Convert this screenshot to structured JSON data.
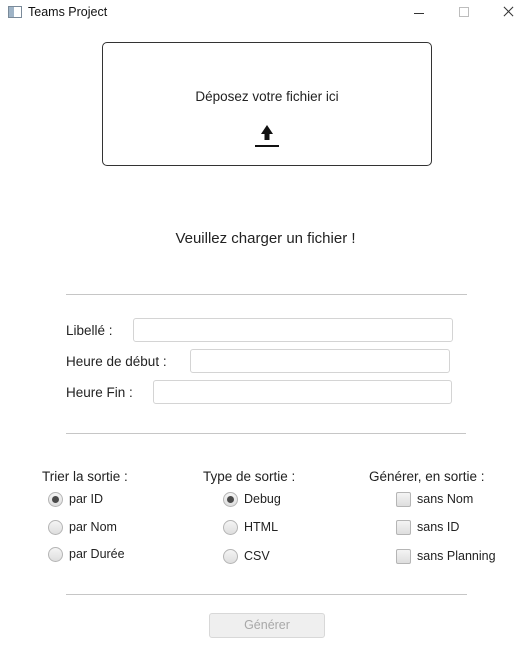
{
  "window": {
    "title": "Teams Project"
  },
  "dropzone": {
    "text": "Déposez votre fichier ici",
    "icon": "upload-icon"
  },
  "status": {
    "message": "Veuillez charger un fichier !"
  },
  "form": {
    "libelle_label": "Libellé :",
    "libelle_value": "",
    "heure_debut_label": "Heure de début :",
    "heure_debut_value": "",
    "heure_fin_label": "Heure Fin :",
    "heure_fin_value": ""
  },
  "sort": {
    "title": "Trier la sortie :",
    "options": [
      {
        "label": "par ID",
        "selected": true
      },
      {
        "label": "par Nom",
        "selected": false
      },
      {
        "label": "par Durée",
        "selected": false
      }
    ]
  },
  "output_type": {
    "title": "Type de sortie :",
    "options": [
      {
        "label": "Debug",
        "selected": true
      },
      {
        "label": "HTML",
        "selected": false
      },
      {
        "label": "CSV",
        "selected": false
      }
    ]
  },
  "generate_options": {
    "title": "Générer, en sortie :",
    "options": [
      {
        "label": "sans Nom",
        "checked": false
      },
      {
        "label": "sans ID",
        "checked": false
      },
      {
        "label": "sans Planning",
        "checked": false
      }
    ]
  },
  "actions": {
    "generate_label": "Générer",
    "generate_enabled": false
  }
}
